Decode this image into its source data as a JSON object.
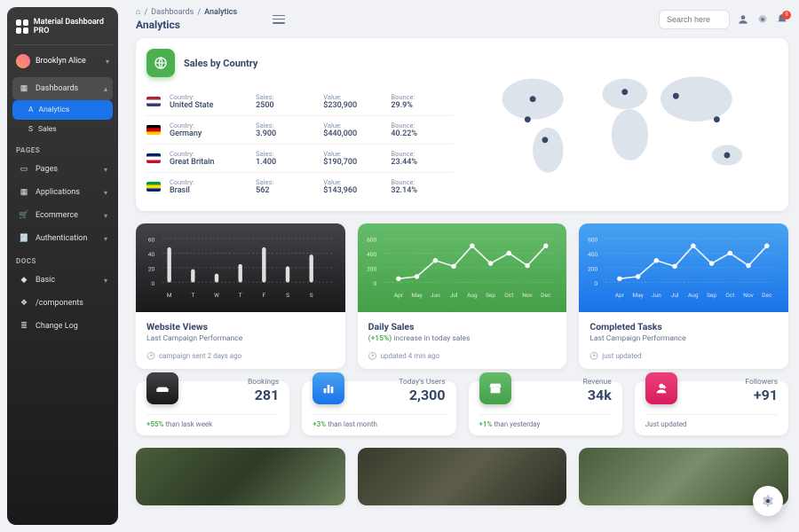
{
  "brand": "Material Dashboard PRO",
  "user": {
    "name": "Brooklyn Alice"
  },
  "nav": {
    "dashboards": "Dashboards",
    "analytics": "Analytics",
    "sales": "Sales",
    "pages_hdr": "PAGES",
    "pages": "Pages",
    "applications": "Applications",
    "ecommerce": "Ecommerce",
    "authentication": "Authentication",
    "docs_hdr": "DOCS",
    "basic": "Basic",
    "components": "/components",
    "changelog": "Change Log"
  },
  "breadcrumb": {
    "root": "Dashboards",
    "current": "Analytics"
  },
  "page_title": "Analytics",
  "search_placeholder": "Search here",
  "notif_count": "9",
  "country_card": {
    "title": "Sales by Country",
    "labels": {
      "country": "Country:",
      "sales": "Sales:",
      "value": "Value:",
      "bounce": "Bounce:"
    },
    "rows": [
      {
        "country": "United State",
        "sales": "2500",
        "value": "$230,900",
        "bounce": "29.9%",
        "flag": "#b22234,#fff,#3c3b6e"
      },
      {
        "country": "Germany",
        "sales": "3.900",
        "value": "$440,000",
        "bounce": "40.22%",
        "flag": "#000,#dd0000,#ffce00"
      },
      {
        "country": "Great Britain",
        "sales": "1.400",
        "value": "$190,700",
        "bounce": "23.44%",
        "flag": "#012169,#fff,#c8102e"
      },
      {
        "country": "Brasil",
        "sales": "562",
        "value": "$143,960",
        "bounce": "32.14%",
        "flag": "#009c3b,#ffdf00,#002776"
      }
    ]
  },
  "chart_data": [
    {
      "type": "bar",
      "title": "Website Views",
      "subtitle": "Last Campaign Performance",
      "footer": "campaign sent 2 days ago",
      "categories": [
        "M",
        "T",
        "W",
        "T",
        "F",
        "S",
        "S"
      ],
      "values": [
        48,
        18,
        12,
        25,
        48,
        22,
        38
      ],
      "ylim": [
        0,
        60
      ],
      "yticks": [
        0,
        20,
        40,
        60
      ]
    },
    {
      "type": "line",
      "title": "Daily Sales",
      "subtitle_prefix": "(+15%)",
      "subtitle": " increase in today sales",
      "footer": "updated 4 min ago",
      "categories": [
        "Apr",
        "May",
        "Jun",
        "Jul",
        "Aug",
        "Sep",
        "Oct",
        "Nov",
        "Dec"
      ],
      "values": [
        50,
        80,
        300,
        220,
        500,
        260,
        400,
        230,
        500
      ],
      "ylim": [
        0,
        600
      ],
      "yticks": [
        0,
        200,
        400,
        600
      ]
    },
    {
      "type": "line",
      "title": "Completed Tasks",
      "subtitle": "Last Campaign Performance",
      "footer": "just updated",
      "categories": [
        "Apr",
        "May",
        "Jun",
        "Jul",
        "Aug",
        "Sep",
        "Oct",
        "Nov",
        "Dec"
      ],
      "values": [
        50,
        80,
        300,
        220,
        500,
        260,
        400,
        230,
        500
      ],
      "ylim": [
        0,
        600
      ],
      "yticks": [
        0,
        200,
        400,
        600
      ]
    }
  ],
  "stats": [
    {
      "icon": "weekend",
      "label": "Bookings",
      "value": "281",
      "delta": "+55%",
      "delta_text": " than lask week"
    },
    {
      "icon": "bar",
      "label": "Today's Users",
      "value": "2,300",
      "delta": "+3%",
      "delta_text": " than last month"
    },
    {
      "icon": "store",
      "label": "Revenue",
      "value": "34k",
      "delta": "+1%",
      "delta_text": " than yesterday"
    },
    {
      "icon": "person",
      "label": "Followers",
      "value": "+91",
      "delta": "",
      "delta_text": "Just updated"
    }
  ]
}
